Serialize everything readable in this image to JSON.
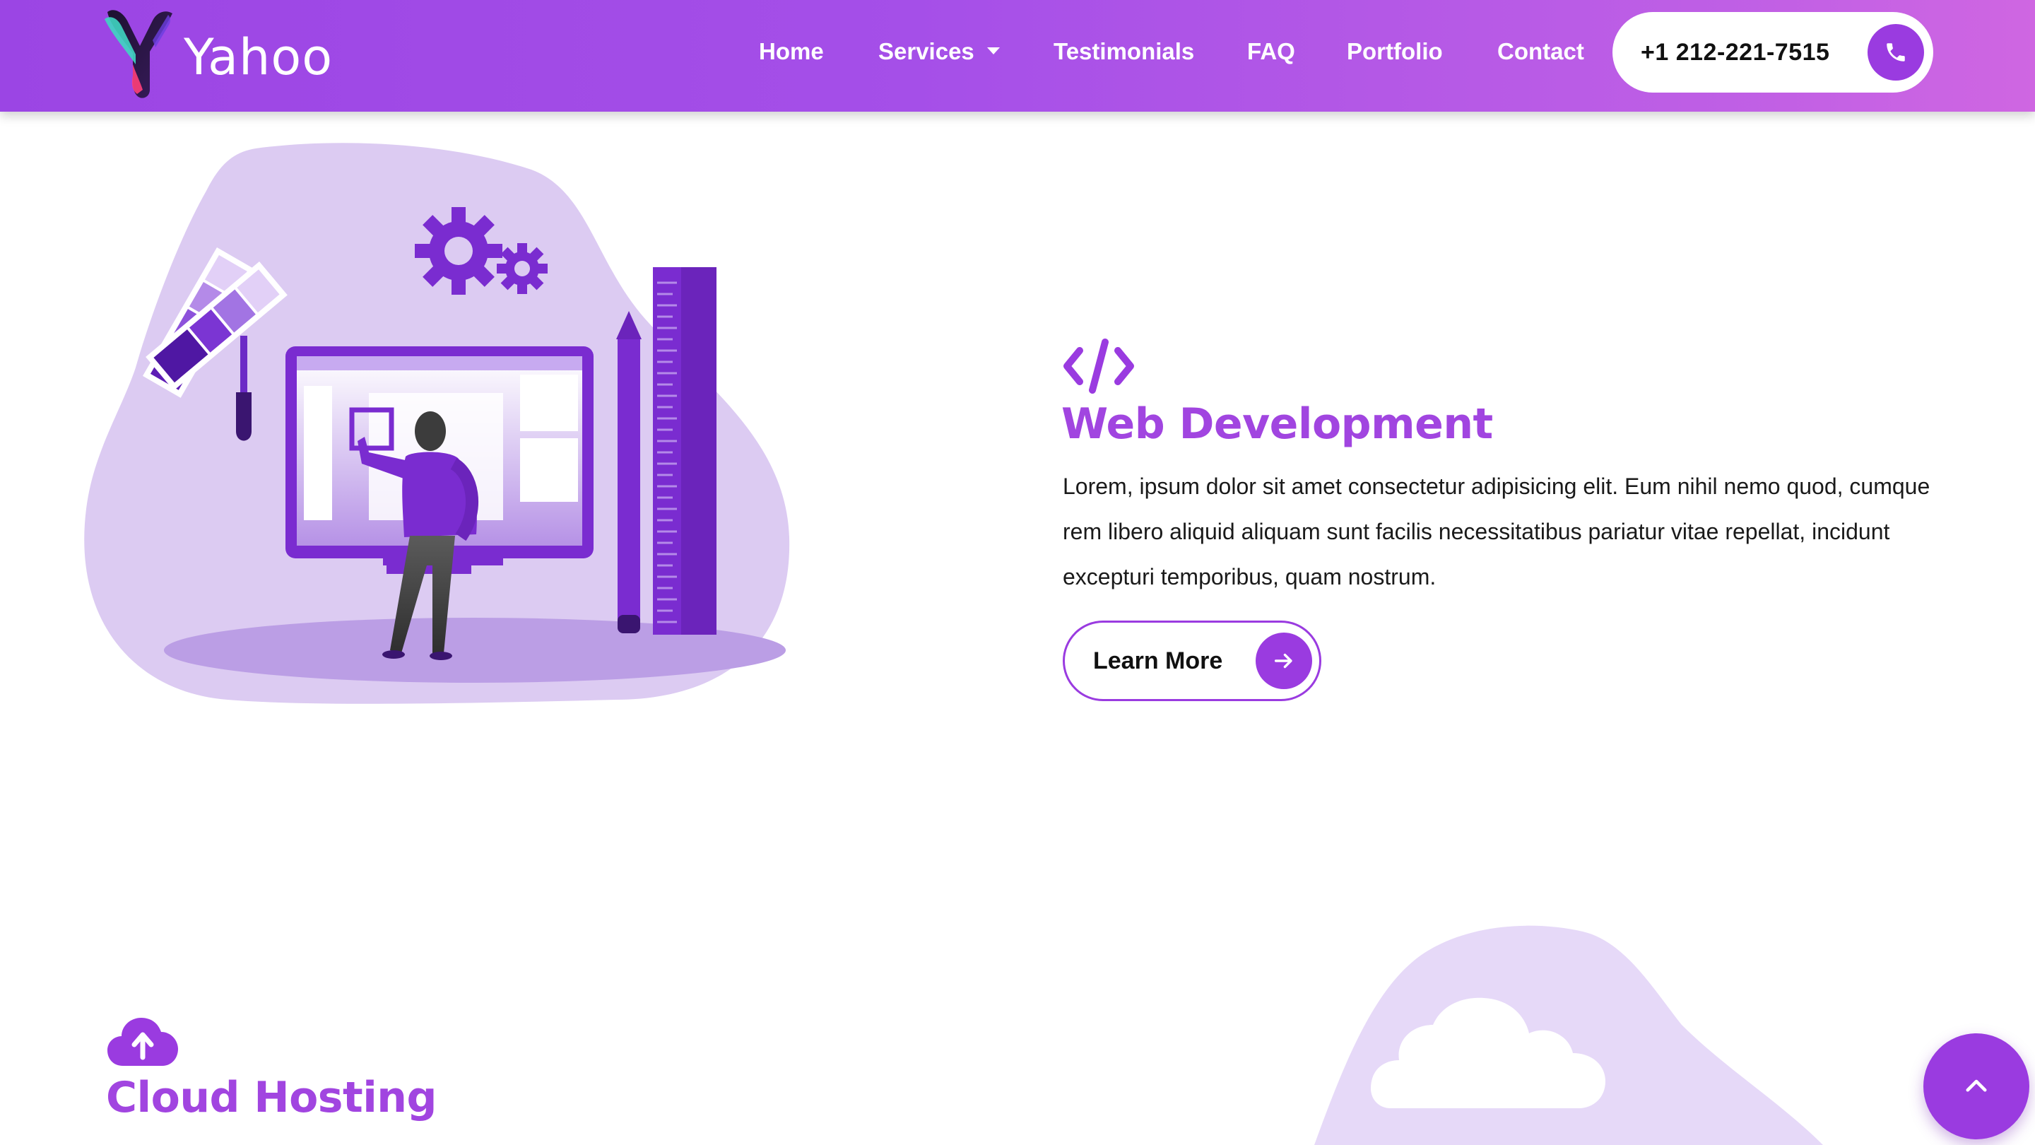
{
  "brand": {
    "name": "Yahoo",
    "logo_icon": "y-logo-icon"
  },
  "nav": {
    "items": [
      {
        "label": "Home"
      },
      {
        "label": "Services",
        "has_dropdown": true
      },
      {
        "label": "Testimonials"
      },
      {
        "label": "FAQ"
      },
      {
        "label": "Portfolio"
      },
      {
        "label": "Contact"
      }
    ],
    "phone": {
      "number": "+1 212-221-7515",
      "icon": "phone-icon"
    }
  },
  "services": [
    {
      "icon": "code-icon",
      "title": "Web Development",
      "description": "Lorem, ipsum dolor sit amet consectetur adipisicing elit. Eum nihil nemo quod, cumque rem libero aliquid aliquam sunt facilis necessitatibus pariatur vitae repellat, incidunt excepturi temporibus, quam nostrum.",
      "button_label": "Learn More",
      "button_icon": "arrow-right-icon"
    },
    {
      "icon": "cloud-upload-icon",
      "title": "Cloud Hosting"
    }
  ],
  "scroll_top_icon": "chevron-up-icon",
  "colors": {
    "accent": "#9a3be0",
    "title": "#a145e0",
    "nav_gradient_start": "#9b45e4",
    "nav_gradient_end": "#cf66e2",
    "blob": "#dccbf2"
  }
}
